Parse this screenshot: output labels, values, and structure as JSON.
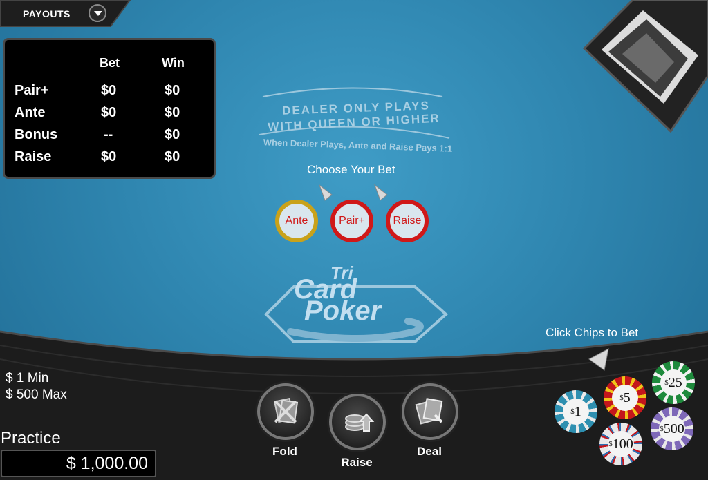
{
  "payouts": {
    "label": "PAYOUTS"
  },
  "paytable": {
    "headers": {
      "bet": "Bet",
      "win": "Win"
    },
    "rows": [
      {
        "name": "Pair+",
        "bet": "$0",
        "win": "$0"
      },
      {
        "name": "Ante",
        "bet": "$0",
        "win": "$0"
      },
      {
        "name": "Bonus",
        "bet": "--",
        "win": "$0"
      },
      {
        "name": "Raise",
        "bet": "$0",
        "win": "$0"
      }
    ]
  },
  "felt": {
    "line1": "DEALER ONLY PLAYS",
    "line2": "WITH QUEEN OR HIGHER",
    "line3": "When Dealer Plays, Ante and Raise Pays 1:1",
    "logo_tri": "Tri",
    "logo_card": "Card",
    "logo_poker": "Poker"
  },
  "prompts": {
    "choose_bet": "Choose Your Bet",
    "click_chips": "Click Chips to Bet"
  },
  "bet_spots": {
    "ante": "Ante",
    "pairplus": "Pair+",
    "raise": "Raise"
  },
  "limits": {
    "min": "$ 1  Min",
    "max": "$ 500  Max"
  },
  "balance": {
    "label": "Practice",
    "value": "$ 1,000.00"
  },
  "actions": {
    "fold": "Fold",
    "raise": "Raise",
    "deal": "Deal"
  },
  "chips": {
    "c1": "1",
    "c5": "5",
    "c25": "25",
    "c100": "100",
    "c500": "500",
    "currency": "$"
  },
  "colors": {
    "felt": "#2f86b0",
    "spot_ante_ring": "#c9a21a",
    "spot_ring": "#d01818"
  }
}
